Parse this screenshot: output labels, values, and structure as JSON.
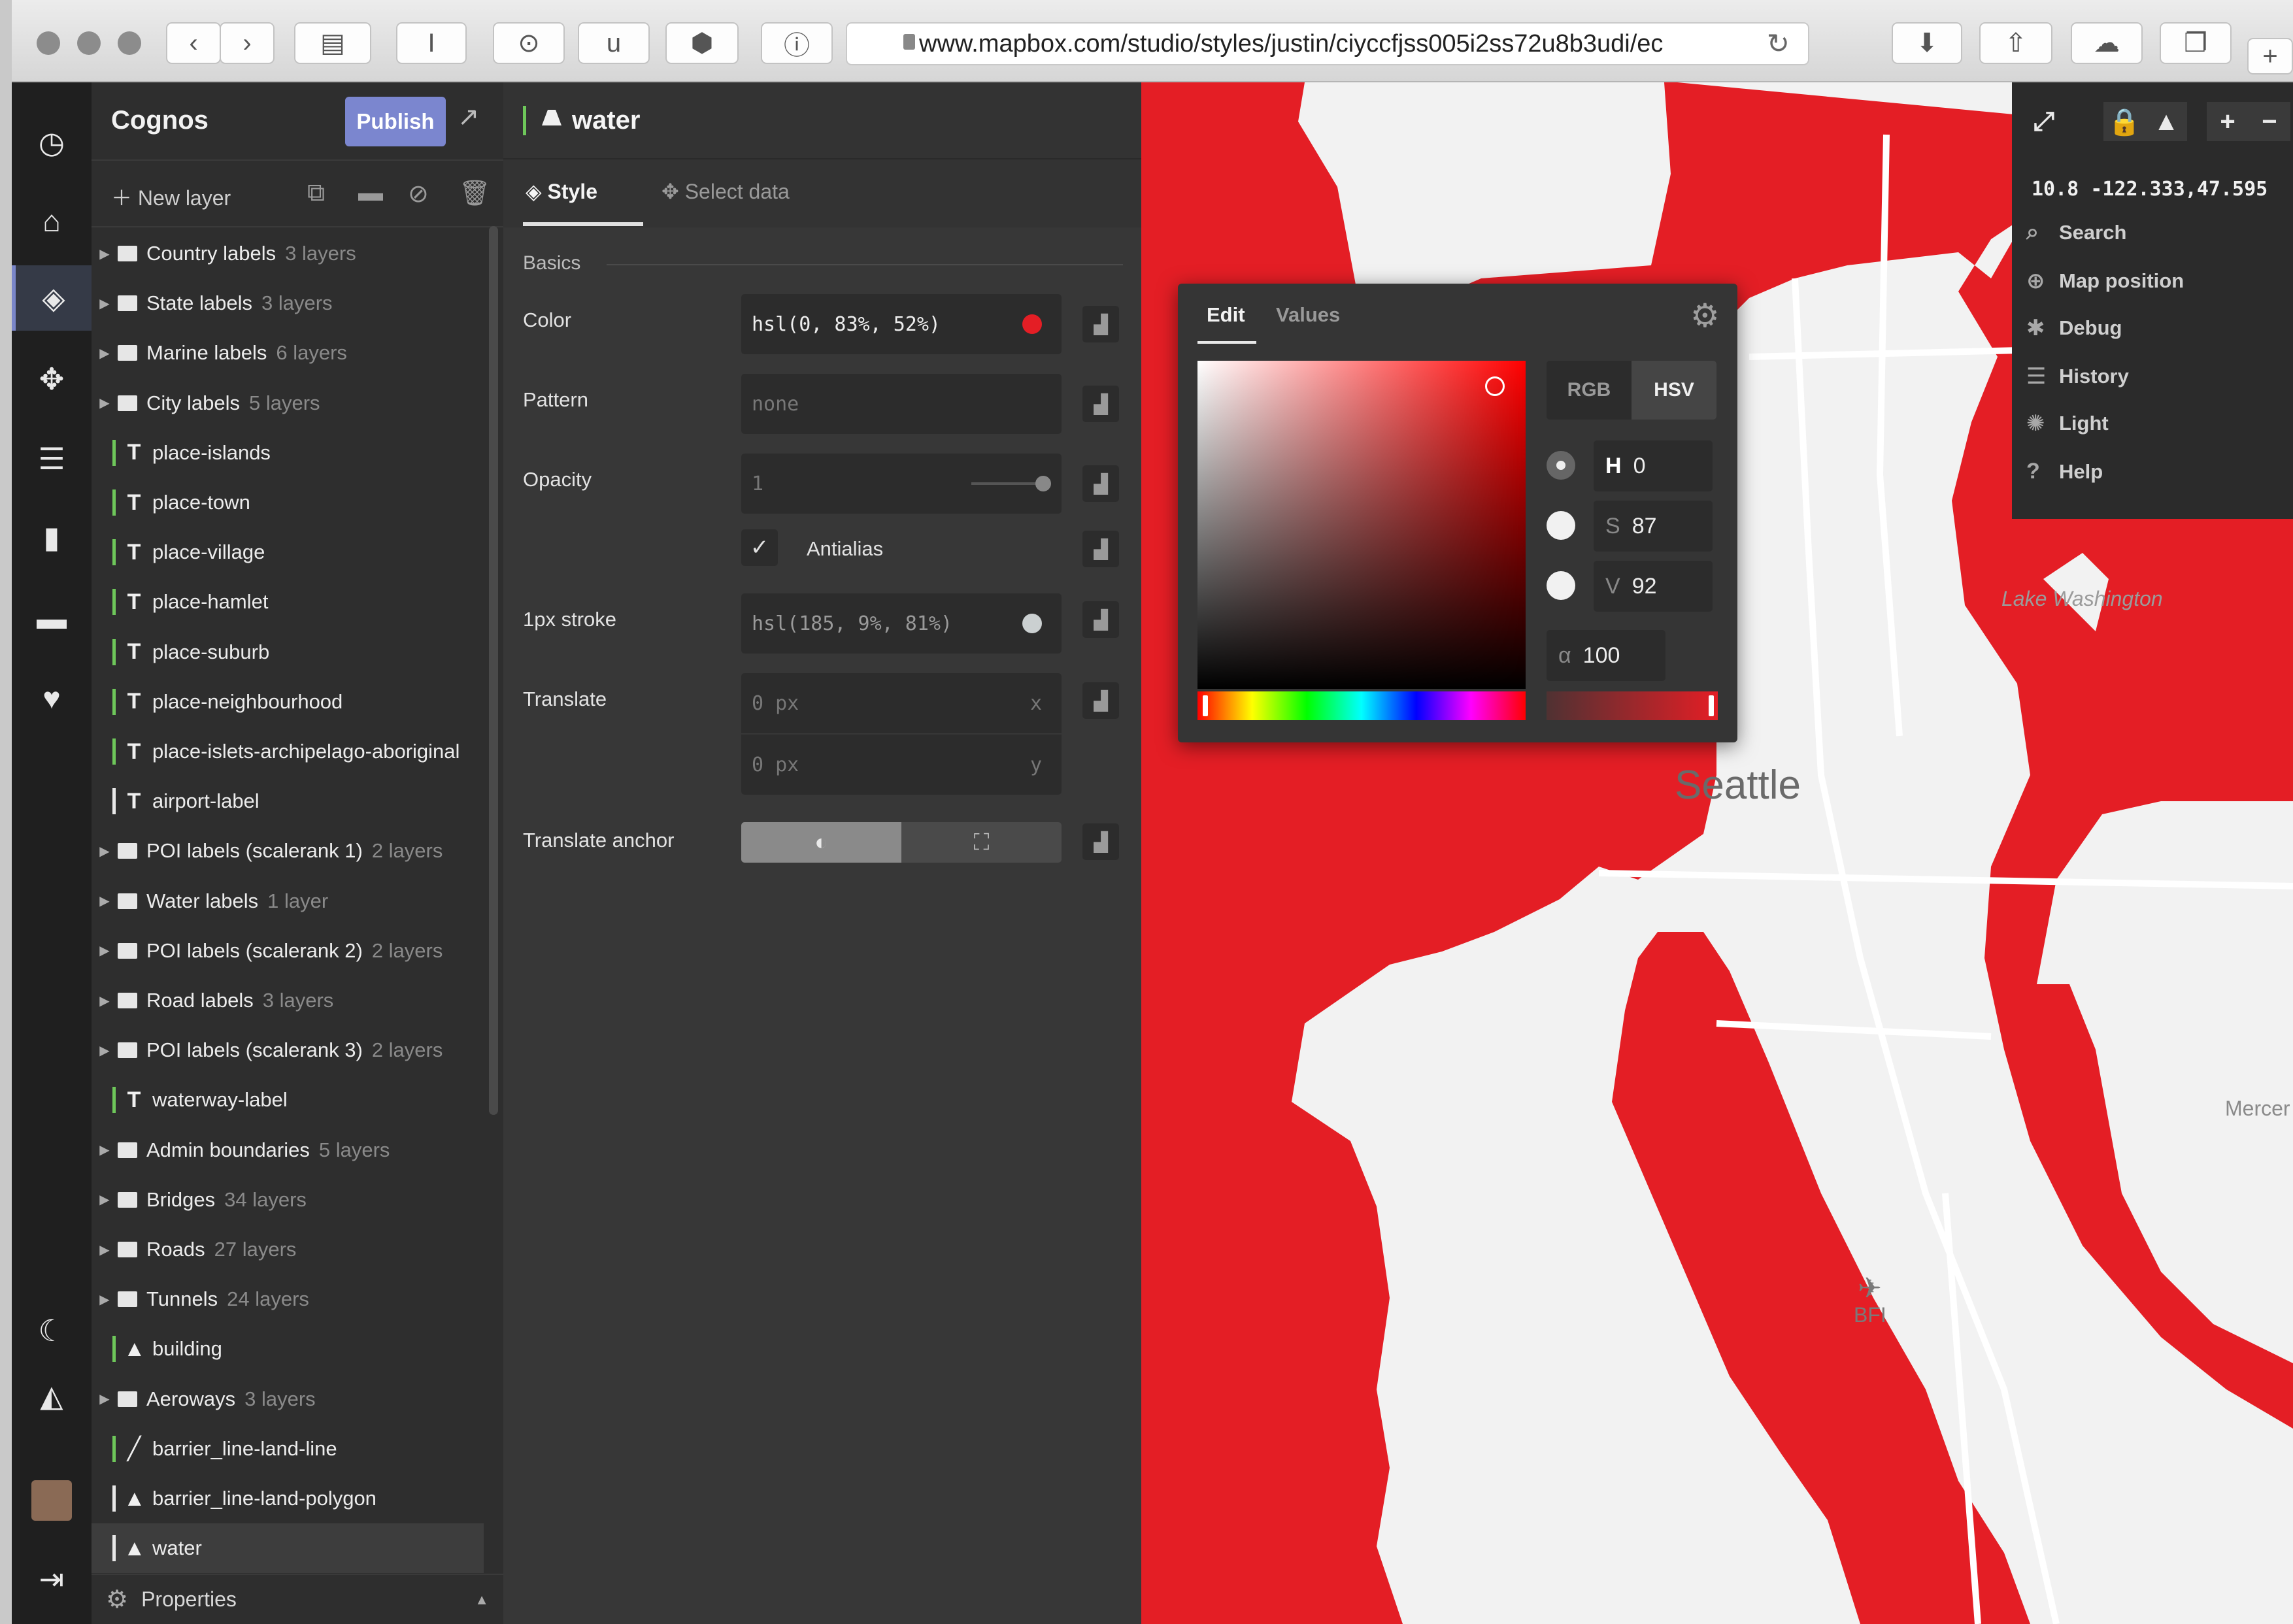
{
  "browser": {
    "url": "www.mapbox.com/studio/styles/justin/ciyccfjss005i2ss72u8b3udi/ec",
    "buttons": [
      "‹",
      "›",
      "▤",
      "I",
      "⊙",
      "u",
      "⬢",
      "ⓘ"
    ]
  },
  "sidebar_icons": [
    "clock-icon",
    "home-icon",
    "paint-bucket-icon",
    "dataset-icon",
    "database-icon",
    "chart-icon",
    "folder-icon",
    "heart-icon",
    "moon-icon",
    "bell-icon",
    "avatar",
    "logout-icon"
  ],
  "layers_panel": {
    "title": "Cognos",
    "publish_label": "Publish",
    "new_layer_label": "New layer",
    "properties_label": "Properties",
    "layers": [
      {
        "kind": "group",
        "name": "Country labels",
        "count": "3 layers"
      },
      {
        "kind": "group",
        "name": "State labels",
        "count": "3 layers"
      },
      {
        "kind": "group",
        "name": "Marine labels",
        "count": "6 layers"
      },
      {
        "kind": "group",
        "name": "City labels",
        "count": "5 layers"
      },
      {
        "kind": "symbol",
        "name": "place-islands",
        "count": ""
      },
      {
        "kind": "symbol",
        "name": "place-town",
        "count": ""
      },
      {
        "kind": "symbol",
        "name": "place-village",
        "count": ""
      },
      {
        "kind": "symbol",
        "name": "place-hamlet",
        "count": ""
      },
      {
        "kind": "symbol",
        "name": "place-suburb",
        "count": ""
      },
      {
        "kind": "symbol",
        "name": "place-neighbourhood",
        "count": ""
      },
      {
        "kind": "symbol",
        "name": "place-islets-archipelago-aboriginal",
        "count": ""
      },
      {
        "kind": "symbol-white",
        "name": "airport-label",
        "count": ""
      },
      {
        "kind": "group",
        "name": "POI labels (scalerank 1)",
        "count": "2 layers"
      },
      {
        "kind": "group",
        "name": "Water labels",
        "count": "1 layer"
      },
      {
        "kind": "group",
        "name": "POI labels (scalerank 2)",
        "count": "2 layers"
      },
      {
        "kind": "group",
        "name": "Road labels",
        "count": "3 layers"
      },
      {
        "kind": "group",
        "name": "POI labels (scalerank 3)",
        "count": "2 layers"
      },
      {
        "kind": "symbol",
        "name": "waterway-label",
        "count": ""
      },
      {
        "kind": "group",
        "name": "Admin boundaries",
        "count": "5 layers"
      },
      {
        "kind": "group",
        "name": "Bridges",
        "count": "34 layers"
      },
      {
        "kind": "group",
        "name": "Roads",
        "count": "27 layers"
      },
      {
        "kind": "group",
        "name": "Tunnels",
        "count": "24 layers"
      },
      {
        "kind": "fill",
        "name": "building",
        "count": ""
      },
      {
        "kind": "group",
        "name": "Aeroways",
        "count": "3 layers"
      },
      {
        "kind": "line",
        "name": "barrier_line-land-line",
        "count": ""
      },
      {
        "kind": "fill-white",
        "name": "barrier_line-land-polygon",
        "count": ""
      },
      {
        "kind": "fill-white",
        "name": "water",
        "count": "",
        "selected": true
      }
    ]
  },
  "style_panel": {
    "layer_name": "water",
    "tab_style": "Style",
    "tab_select": "Select data",
    "section": "Basics",
    "color_label": "Color",
    "color_value": "hsl(0, 83%, 52%)",
    "color_swatch": "#e41e25",
    "pattern_label": "Pattern",
    "pattern_placeholder": "none",
    "opacity_label": "Opacity",
    "opacity_value": "1",
    "antialias_label": "Antialias",
    "stroke_label": "1px stroke",
    "stroke_value": "hsl(185, 9%, 81%)",
    "stroke_swatch": "#cbd0d1",
    "translate_label": "Translate",
    "translate_x": "0 px",
    "translate_x_axis": "x",
    "translate_y": "0 px",
    "translate_y_axis": "y",
    "anchor_label": "Translate anchor"
  },
  "color_picker": {
    "tab_edit": "Edit",
    "tab_values": "Values",
    "mode_rgb": "RGB",
    "mode_hsv": "HSV",
    "h_key": "H",
    "h_val": "0",
    "s_key": "S",
    "s_val": "87",
    "v_key": "V",
    "v_val": "92",
    "a_key": "α",
    "a_val": "100"
  },
  "map_controls": {
    "coords": "10.8 -122.333,47.595",
    "items": [
      "Search",
      "Map position",
      "Debug",
      "History",
      "Light",
      "Help"
    ]
  },
  "map_labels": {
    "city": "Seattle",
    "lake": "Lake Washington",
    "mercer": "Mercer",
    "airport": "BFI",
    "water_color": "#e41e25",
    "land_color": "#f2f2f2"
  }
}
